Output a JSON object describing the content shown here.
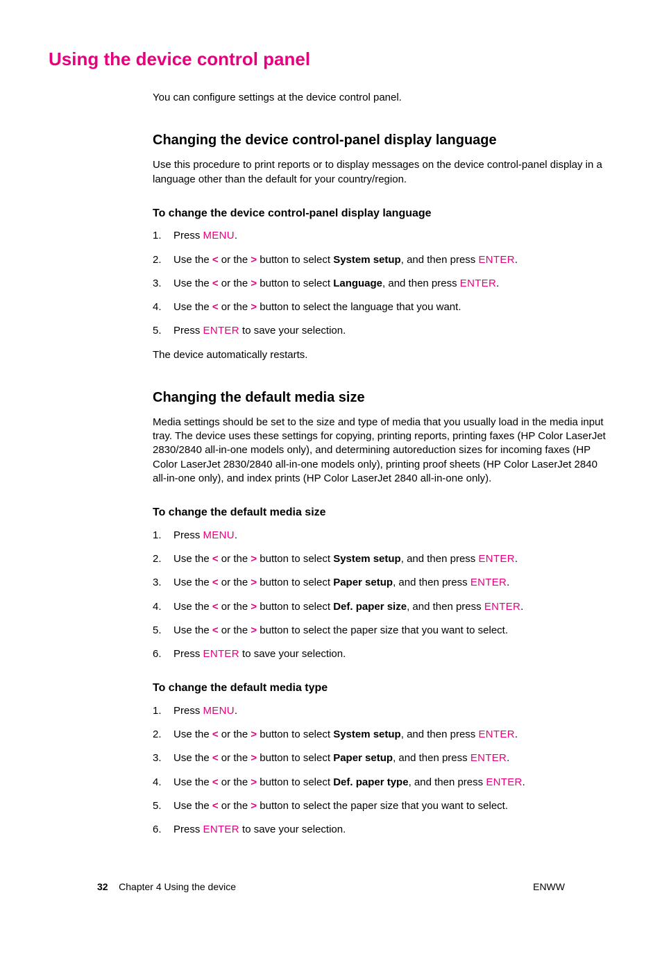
{
  "title": "Using the device control panel",
  "intro": "You can configure settings at the device control panel.",
  "keys": {
    "menu": "Menu",
    "enter": "Enter"
  },
  "arrows": {
    "lt": "<",
    "gt": ">"
  },
  "s1": {
    "heading": "Changing the device control-panel display language",
    "body": "Use this procedure to print reports or to display messages on the device control-panel display in a language other than the default for your country/region.",
    "sub": "To change the device control-panel display language",
    "steps": {
      "1a": "Press ",
      "1b": ".",
      "2a": "Use the ",
      "2b": " or the ",
      "2c": " button to select ",
      "2bold": "System setup",
      "2d": ", and then press ",
      "2e": ".",
      "3a": "Use the ",
      "3b": " or the ",
      "3c": " button to select ",
      "3bold": "Language",
      "3d": ", and then press ",
      "3e": ".",
      "4a": "Use the ",
      "4b": " or the ",
      "4c": " button to select the language that you want.",
      "5a": "Press ",
      "5b": " to save your selection."
    },
    "after": "The device automatically restarts."
  },
  "s2": {
    "heading": "Changing the default media size",
    "body": "Media settings should be set to the size and type of media that you usually load in the media input tray. The device uses these settings for copying, printing reports, printing faxes (HP Color LaserJet 2830/2840 all-in-one models only), and determining autoreduction sizes for incoming faxes (HP Color LaserJet 2830/2840 all-in-one models only), printing proof sheets (HP Color LaserJet 2840 all-in-one only), and index prints (HP Color LaserJet 2840 all-in-one only).",
    "sub1": "To change the default media size",
    "steps1": {
      "1a": "Press ",
      "1b": ".",
      "2a": "Use the ",
      "2b": " or the ",
      "2c": " button to select ",
      "2bold": "System setup",
      "2d": ", and then press ",
      "2e": ".",
      "3a": "Use the ",
      "3b": " or the ",
      "3c": " button to select ",
      "3bold": "Paper setup",
      "3d": ", and then press ",
      "3e": ".",
      "4a": "Use the ",
      "4b": " or the ",
      "4c": " button to select ",
      "4bold": "Def. paper size",
      "4d": ", and then press ",
      "4e": ".",
      "5a": "Use the ",
      "5b": " or the ",
      "5c": " button to select the paper size that you want to select.",
      "6a": "Press ",
      "6b": " to save your selection."
    },
    "sub2": "To change the default media type",
    "steps2": {
      "1a": "Press ",
      "1b": ".",
      "2a": "Use the ",
      "2b": " or the ",
      "2c": " button to select ",
      "2bold": "System setup",
      "2d": ", and then press ",
      "2e": ".",
      "3a": "Use the ",
      "3b": " or the ",
      "3c": " button to select ",
      "3bold": "Paper setup",
      "3d": ", and then press ",
      "3e": ".",
      "4a": "Use the ",
      "4b": " or the ",
      "4c": " button to select ",
      "4bold": "Def. paper type",
      "4d": ", and then press ",
      "4e": ".",
      "5a": "Use the ",
      "5b": " or the ",
      "5c": " button to select the paper size that you want to select.",
      "6a": "Press ",
      "6b": " to save your selection."
    }
  },
  "footer": {
    "page": "32",
    "chapter": "Chapter 4  Using the device",
    "lang": "ENWW"
  }
}
